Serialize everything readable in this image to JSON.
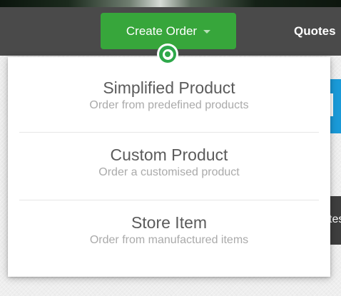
{
  "navbar": {
    "create_order_label": "Create Order",
    "quotes_label": "Quotes"
  },
  "background": {
    "partial_text": "tes"
  },
  "dropdown": {
    "items": [
      {
        "title": "Simplified Product",
        "subtitle": "Order from predefined products"
      },
      {
        "title": "Custom Product",
        "subtitle": "Order a customised product"
      },
      {
        "title": "Store Item",
        "subtitle": "Order from manufactured items"
      }
    ]
  },
  "colors": {
    "accent_green": "#37a63b",
    "navbar_bg": "#4a4a4a",
    "info_blue": "#1a9ad8"
  }
}
